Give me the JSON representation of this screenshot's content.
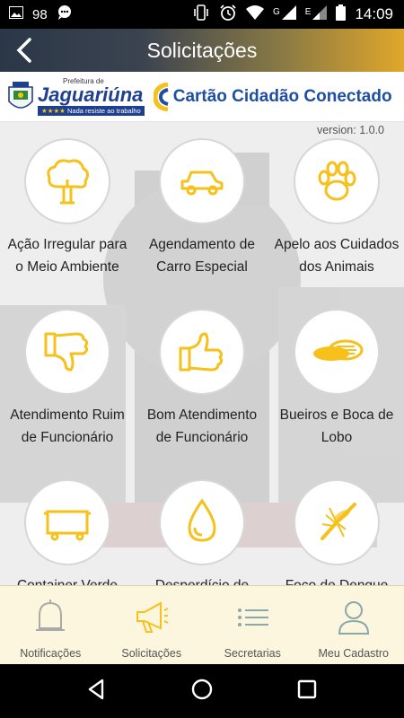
{
  "status_bar": {
    "battery_level": "98",
    "time": "14:09",
    "network_label_1": "G",
    "network_label_2": "E",
    "icons": [
      "image-icon",
      "chat-icon",
      "vibrate-icon",
      "alarm-icon",
      "wifi-icon",
      "signal-icon",
      "battery-icon"
    ]
  },
  "app_bar": {
    "title": "Solicitações",
    "back_icon": "back-arrow-icon",
    "gradient_start": "#2b3747",
    "gradient_end": "#e0a72a"
  },
  "banner": {
    "prefeitura_small": "Prefeitura de",
    "city_name": "Jaguariúna",
    "stars": "★★★★",
    "tagline": "Nada resiste ao trabalho",
    "brand": "Cartão Cidadão Conectado"
  },
  "version": "version: 1.0.0",
  "accent_color": "#f5c11a",
  "tiles": [
    {
      "label": "Ação Irregular para o Meio Ambiente",
      "icon": "tree-icon"
    },
    {
      "label": "Agendamento de Carro Especial",
      "icon": "car-icon"
    },
    {
      "label": "Apelo aos Cuidados dos Animais",
      "icon": "paw-icon"
    },
    {
      "label": "Atendimento Ruim de Funcionário",
      "icon": "thumbs-down-icon"
    },
    {
      "label": "Bom Atendimento de Funcionário",
      "icon": "thumbs-up-icon"
    },
    {
      "label": "Bueiros e Boca de Lobo",
      "icon": "manhole-icon"
    },
    {
      "label": "Container Verde",
      "icon": "container-icon"
    },
    {
      "label": "Desperdício de Água",
      "icon": "water-drop-icon"
    },
    {
      "label": "Foco de Dengue",
      "icon": "mosquito-icon"
    }
  ],
  "bottom_nav": [
    {
      "label": "Notificações",
      "icon": "bell-icon",
      "active": false
    },
    {
      "label": "Solicitações",
      "icon": "megaphone-icon",
      "active": true
    },
    {
      "label": "Secretarias",
      "icon": "list-icon",
      "active": false
    },
    {
      "label": "Meu Cadastro",
      "icon": "person-icon",
      "active": false
    }
  ],
  "system_nav": [
    "back-triangle-icon",
    "home-circle-icon",
    "recents-square-icon"
  ]
}
